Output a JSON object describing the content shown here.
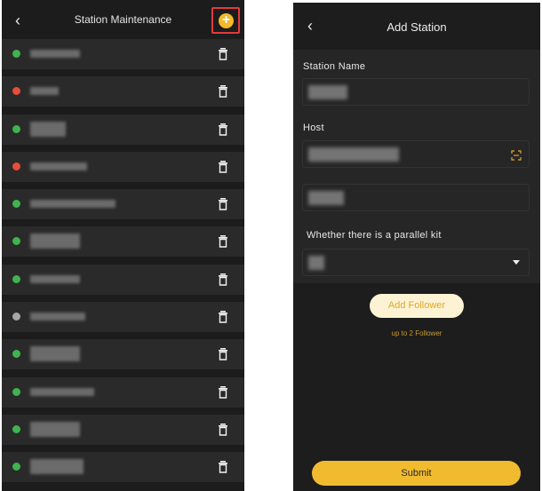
{
  "list_screen": {
    "title": "Station Maintenance",
    "back_icon": "chevron-left-icon",
    "add_icon": "plus-circle-icon",
    "highlight_color": "#e23b3b",
    "stations": [
      {
        "status": "online",
        "color": "#3fb34f",
        "name_redacted": true
      },
      {
        "status": "fault",
        "color": "#e84c3d",
        "name_redacted": true
      },
      {
        "status": "online",
        "color": "#3fb34f",
        "name_redacted": true
      },
      {
        "status": "fault",
        "color": "#e84c3d",
        "name_redacted": true
      },
      {
        "status": "online",
        "color": "#3fb34f",
        "name_redacted": true
      },
      {
        "status": "online",
        "color": "#3fb34f",
        "name_redacted": true
      },
      {
        "status": "online",
        "color": "#3fb34f",
        "name_redacted": true
      },
      {
        "status": "offline",
        "color": "#a7a7a7",
        "name_redacted": true
      },
      {
        "status": "online",
        "color": "#3fb34f",
        "name_redacted": true
      },
      {
        "status": "online",
        "color": "#3fb34f",
        "name_redacted": true
      },
      {
        "status": "online",
        "color": "#3fb34f",
        "name_redacted": true
      },
      {
        "status": "online",
        "color": "#3fb34f",
        "name_redacted": true
      }
    ],
    "row_action_icon": "trash-icon"
  },
  "add_screen": {
    "title": "Add Station",
    "back_icon": "chevron-left-icon",
    "station_name_label": "Station Name",
    "host_label": "Host",
    "parallel_label": "Whether there is a parallel kit",
    "scan_icon": "scan-icon",
    "dropdown_icon": "caret-down-icon",
    "add_follower_label": "Add Follower",
    "follower_note": "up to 2 Follower",
    "submit_label": "Submit",
    "accent_color": "#f1bb2f"
  }
}
